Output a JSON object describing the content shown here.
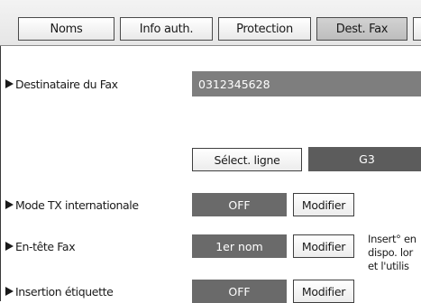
{
  "tabs": [
    {
      "label": "Noms",
      "active": false
    },
    {
      "label": "Info auth.",
      "active": false
    },
    {
      "label": "Protection",
      "active": false
    },
    {
      "label": "Dest. Fax",
      "active": true
    },
    {
      "label": "",
      "active": false
    }
  ],
  "fax_destination": {
    "label": "Destinataire du Fax",
    "value": "0312345628"
  },
  "line_select": {
    "button_label": "Sélect. ligne",
    "value": "G3"
  },
  "intl_tx_mode": {
    "label": "Mode TX internationale",
    "value": "OFF",
    "modify_label": "Modifier"
  },
  "fax_header": {
    "label": "En-tête Fax",
    "value": "1er nom",
    "modify_label": "Modifier",
    "note_lines": [
      "Insert° en",
      "dispo. lor",
      "et l'utilis"
    ]
  },
  "label_insertion": {
    "label": "Insertion étiquette",
    "value": "OFF",
    "modify_label": "Modifier"
  },
  "colors": {
    "active_tab": "#c6c6c6",
    "dark_value": "#6a6a6a",
    "field_bg": "#7e7e7e"
  }
}
